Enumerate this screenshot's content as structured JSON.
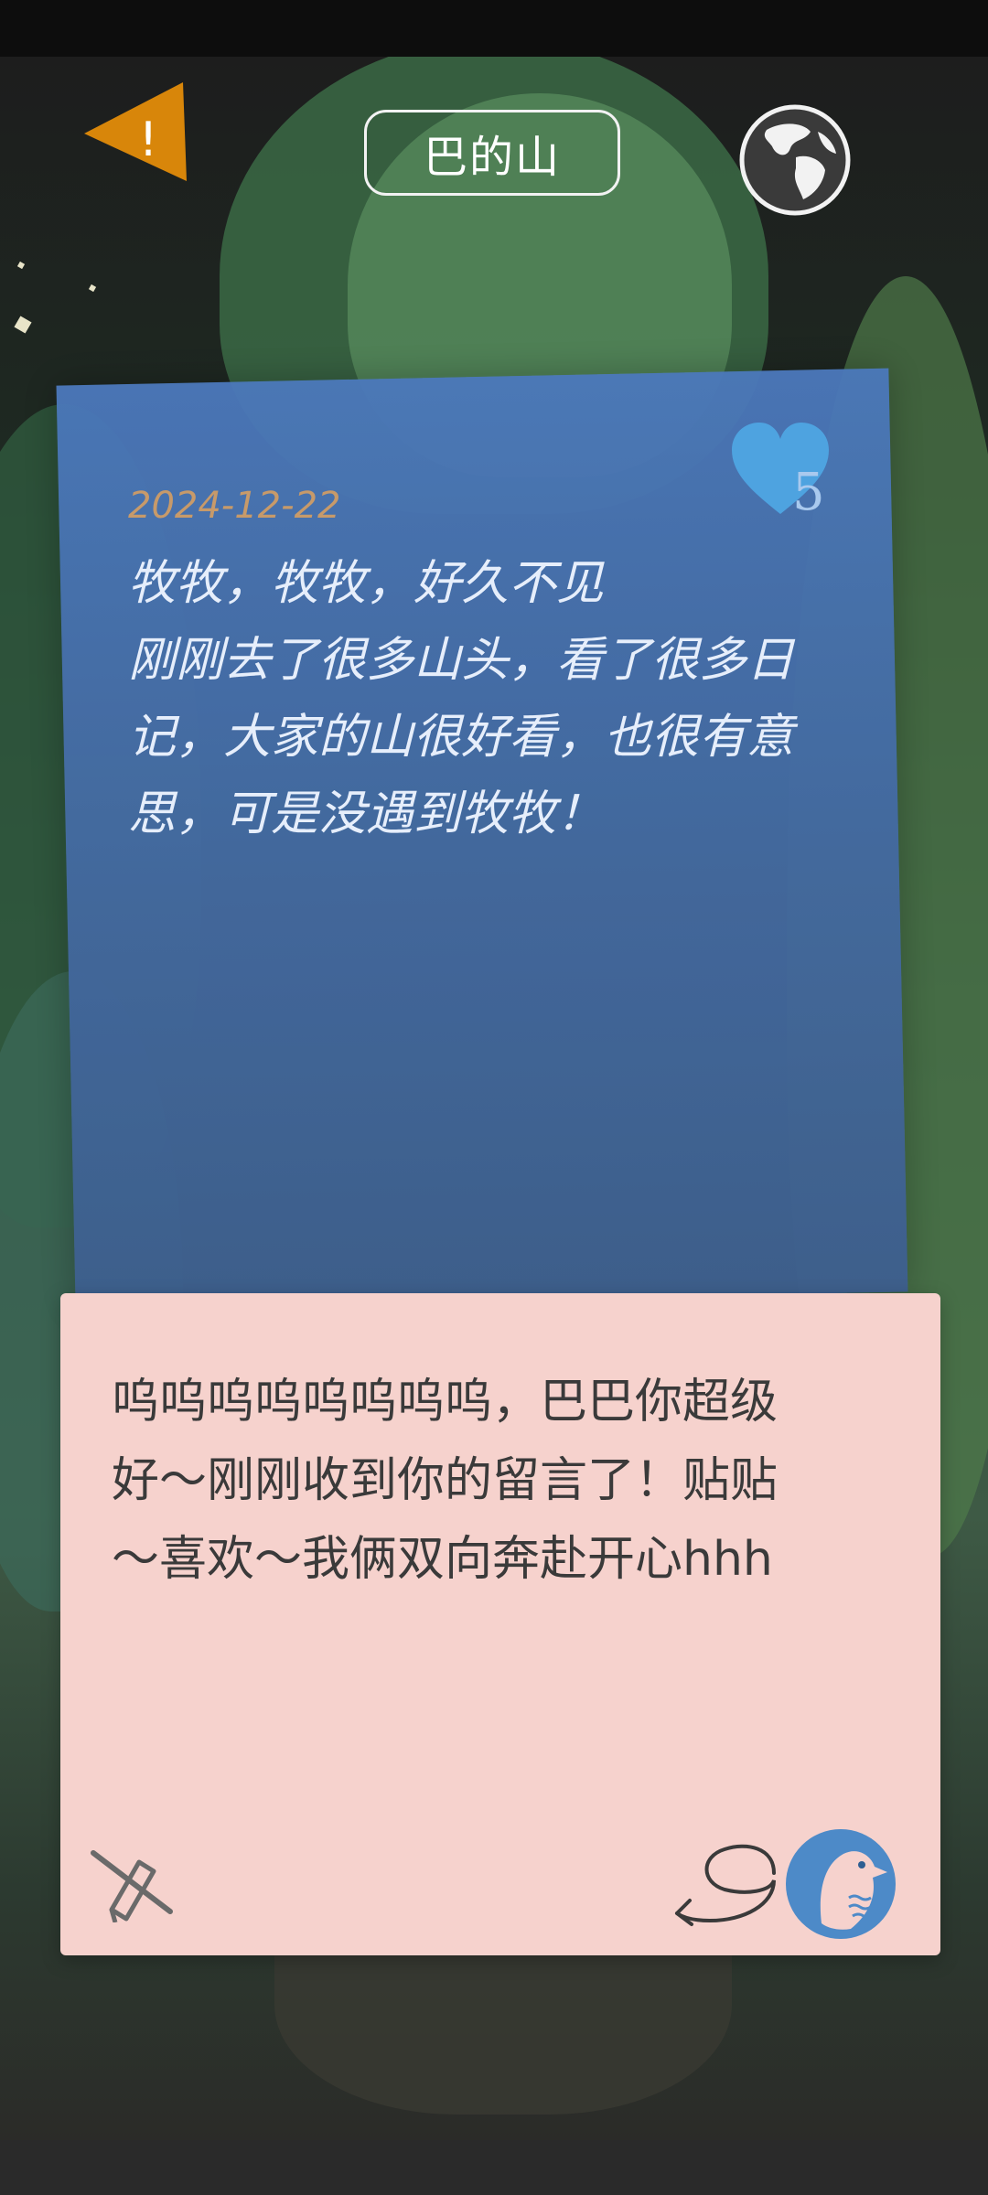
{
  "header": {
    "title": "巴的山",
    "warning_icon": "exclamation-icon",
    "globe_icon": "globe-icon"
  },
  "note": {
    "date": "2024-12-22",
    "body": "牧牧，牧牧，好久不见\n刚刚去了很多山头，看了很多日\n记，大家的山很好看，也很有意\n思，可是没遇到牧牧！",
    "likes": "5"
  },
  "reply": {
    "text": "呜呜呜呜呜呜呜呜，巴巴你超级\n好～刚刚收到你的留言了！贴贴\n～喜欢～我俩双向奔赴开心hhh",
    "icons": [
      "no-pen-icon",
      "return-arrow-icon",
      "bird-icon"
    ]
  },
  "colors": {
    "note_blue": "#4b78ba",
    "reply_pink": "#f6d2cd",
    "warning_orange": "#d8860a",
    "heart_blue": "#4ea3e0"
  }
}
